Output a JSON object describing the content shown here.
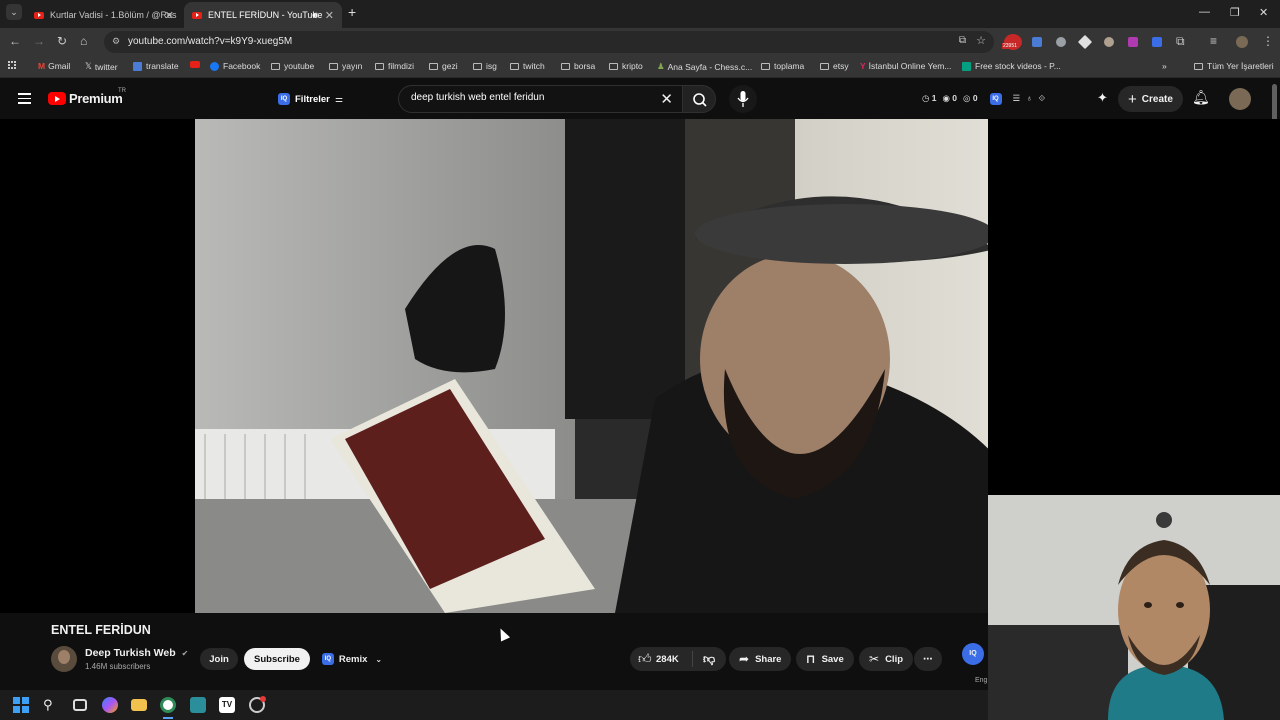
{
  "browser": {
    "tabs": [
      {
        "title": "Kurtlar Vadisi - 1.Bölüm / @Res",
        "active": false
      },
      {
        "title": "ENTEL FERİDUN - YouTube",
        "active": true
      }
    ],
    "new_tab_label": "+",
    "url": "youtube.com/watch?v=k9Y9-xueg5M",
    "extension_badge": "23951",
    "bookmarks": [
      "Gmail",
      "twitter",
      "translate",
      "Facebook",
      "youtube",
      "yayın",
      "filmdizi",
      "gezi",
      "isg",
      "twitch",
      "borsa",
      "kripto",
      "Ana Sayfa - Chess.c...",
      "toplama",
      "etsy",
      "İstanbul Online Yem...",
      "Free stock videos - P..."
    ],
    "all_bookmarks": "Tüm Yer İşaretleri"
  },
  "youtube": {
    "logo_text": "Premium",
    "logo_region": "TR",
    "filters_label": "Filtreler",
    "search_value": "deep turkish web entel feridun",
    "counters": [
      "1",
      "0",
      "0"
    ],
    "create_label": "Create"
  },
  "video": {
    "title": "ENTEL FERİDUN",
    "channel": "Deep Turkish Web",
    "subscribers": "1.46M subscribers",
    "join_label": "Join",
    "subscribe_label": "Subscribe",
    "remix_label": "Remix",
    "likes": "284K",
    "share_label": "Share",
    "save_label": "Save",
    "clip_label": "Clip",
    "side_text": "Eng"
  },
  "colors": {
    "youtube_red": "#ff0000",
    "background": "#0f0f0f",
    "button_bg": "#272727",
    "iq_blue": "#3b6ee6"
  }
}
